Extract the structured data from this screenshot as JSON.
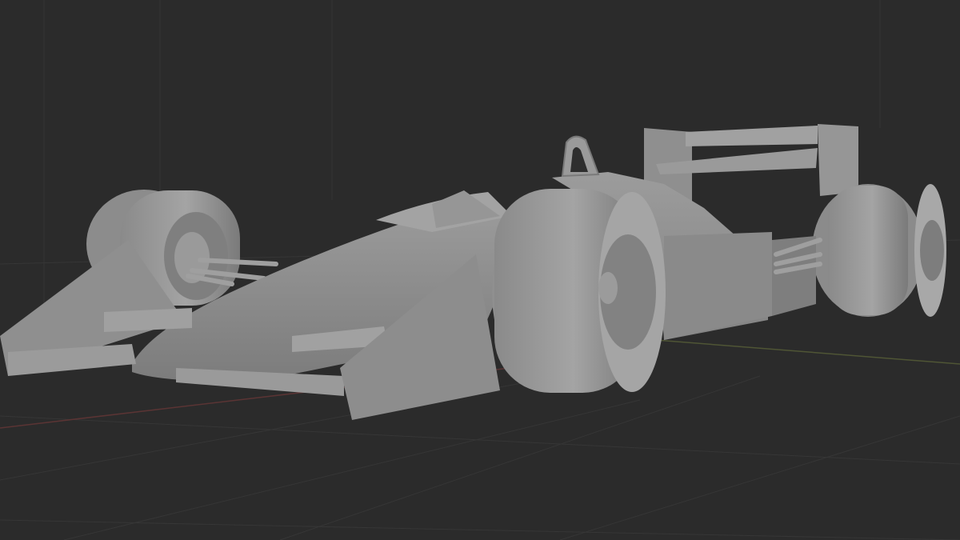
{
  "viewport": {
    "mode": "solid-shading",
    "background_color": "#2b2b2b",
    "grid_color": "#3a3a3a",
    "axis_x_color": "#8a3b3b",
    "axis_y_color": "#5f6a3a",
    "model_base_color": "#8d8d8d",
    "model_light_color": "#a3a3a3",
    "model_dark_color": "#6e6e6e",
    "model": "formula-1-car"
  }
}
